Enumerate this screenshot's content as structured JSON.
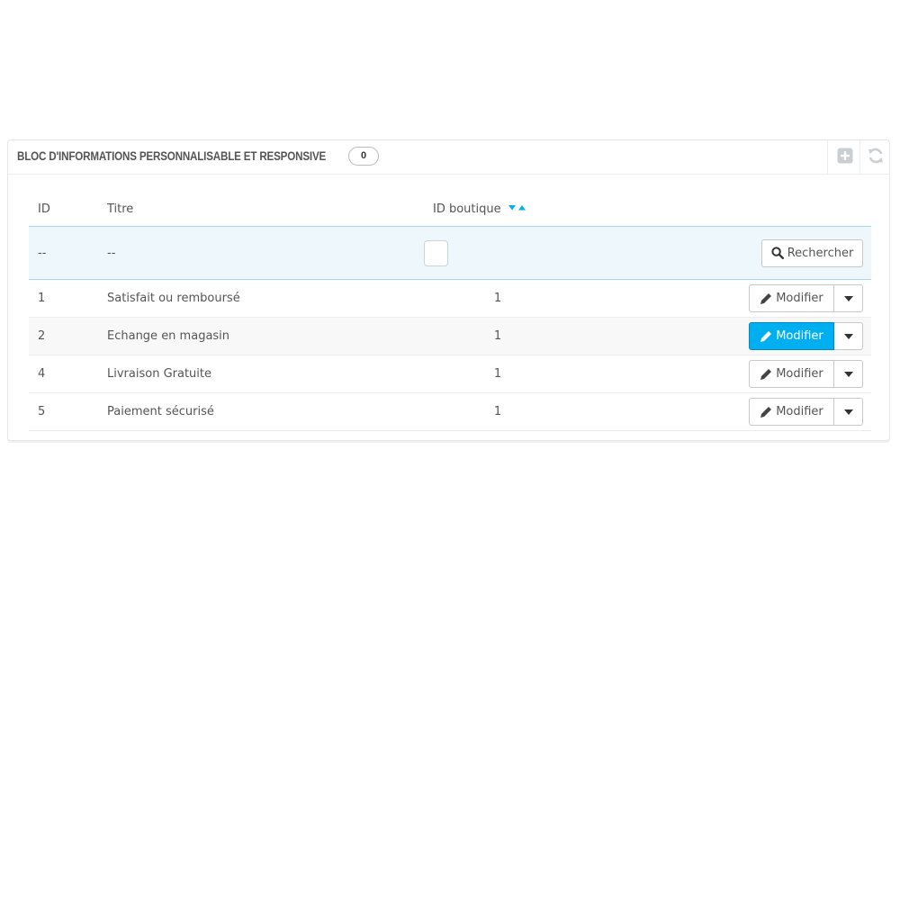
{
  "panel": {
    "title": "BLOC D'INFORMATIONS PERSONNALISABLE ET RESPONSIVE",
    "count_badge": "0",
    "tools": [
      {
        "icon": "plus-square-icon"
      },
      {
        "icon": "refresh-icon"
      }
    ]
  },
  "table": {
    "headers": {
      "id": "ID",
      "title": "Titre",
      "shop_id": "ID boutique"
    },
    "filter": {
      "id": "--",
      "title": "--",
      "search_label": "Rechercher"
    },
    "rows": [
      {
        "id": "1",
        "title": "Satisfait ou remboursé",
        "shop_id": "1",
        "action": "Modifier"
      },
      {
        "id": "2",
        "title": "Echange en magasin",
        "shop_id": "1",
        "action": "Modifier"
      },
      {
        "id": "4",
        "title": "Livraison Gratuite",
        "shop_id": "1",
        "action": "Modifier"
      },
      {
        "id": "5",
        "title": "Paiement sécurisé",
        "shop_id": "1",
        "action": "Modifier"
      }
    ],
    "active_row": 1
  },
  "colors": {
    "accent": "#00aff0",
    "sort_arrow": "#00aff0",
    "filter_row_bg": "#eef7fb"
  }
}
